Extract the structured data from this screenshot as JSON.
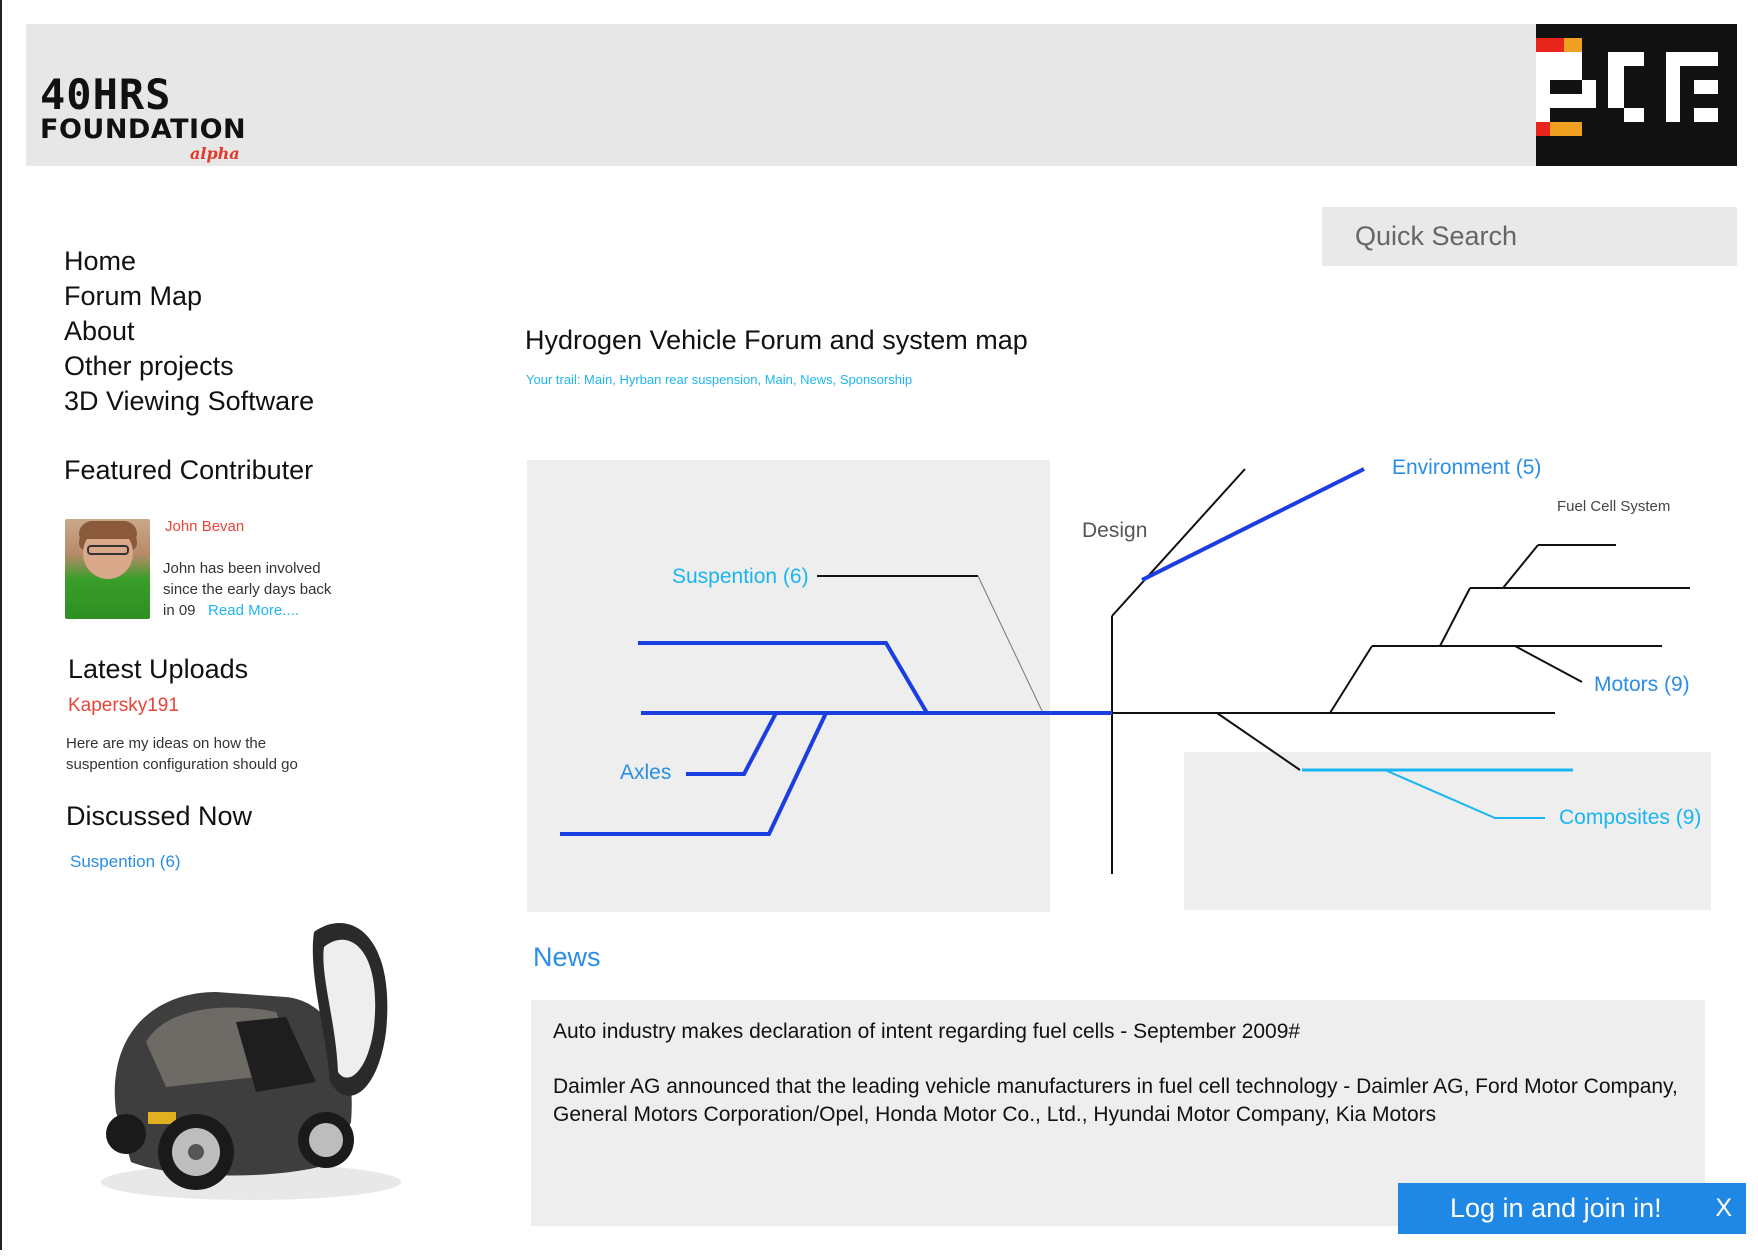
{
  "header": {
    "logo_glyphs": "40HRS",
    "logo_word": "FOUNDATION",
    "logo_tag": "alpha"
  },
  "search": {
    "placeholder": "Quick Search"
  },
  "nav": {
    "items": [
      "Home",
      "Forum Map",
      "About",
      "Other projects",
      "3D Viewing Software"
    ]
  },
  "featured": {
    "heading": "Featured Contributer",
    "name": "John Bevan",
    "bio_line1": "John has been involved",
    "bio_line2": "since the early days back",
    "bio_line3": "in 09",
    "read_more": "Read More...."
  },
  "uploads": {
    "heading": "Latest Uploads",
    "user": "Kapersky191",
    "text_line1": "Here are my ideas on how the",
    "text_line2": "suspention configuration should go"
  },
  "discussed": {
    "heading": "Discussed Now",
    "link": "Suspention (6)"
  },
  "main": {
    "title": "Hydrogen Vehicle Forum and system map",
    "trail": "Your trail: Main, Hyrban rear suspension, Main, News, Sponsorship"
  },
  "map": {
    "suspention": "Suspention (6)",
    "axles": "Axles",
    "design": "Design",
    "environment": "Environment (5)",
    "fuel_cell": "Fuel Cell System",
    "motors": "Motors (9)",
    "composites": "Composites (9)",
    "colors": {
      "highlight": "#1a3ee0",
      "light": "#19b5f2",
      "line": "#111111"
    }
  },
  "news": {
    "heading": "News",
    "headline": "Auto industry makes declaration of intent regarding fuel cells - September 2009#",
    "body": "Daimler AG announced that the leading vehicle manufacturers in fuel cell technology - Daimler AG, Ford Motor Company, General Motors Corporation/Opel, Honda Motor Co., Ltd., Hyundai Motor Company, Kia Motors"
  },
  "login": {
    "label": "Log in and join in!",
    "close": "X"
  }
}
